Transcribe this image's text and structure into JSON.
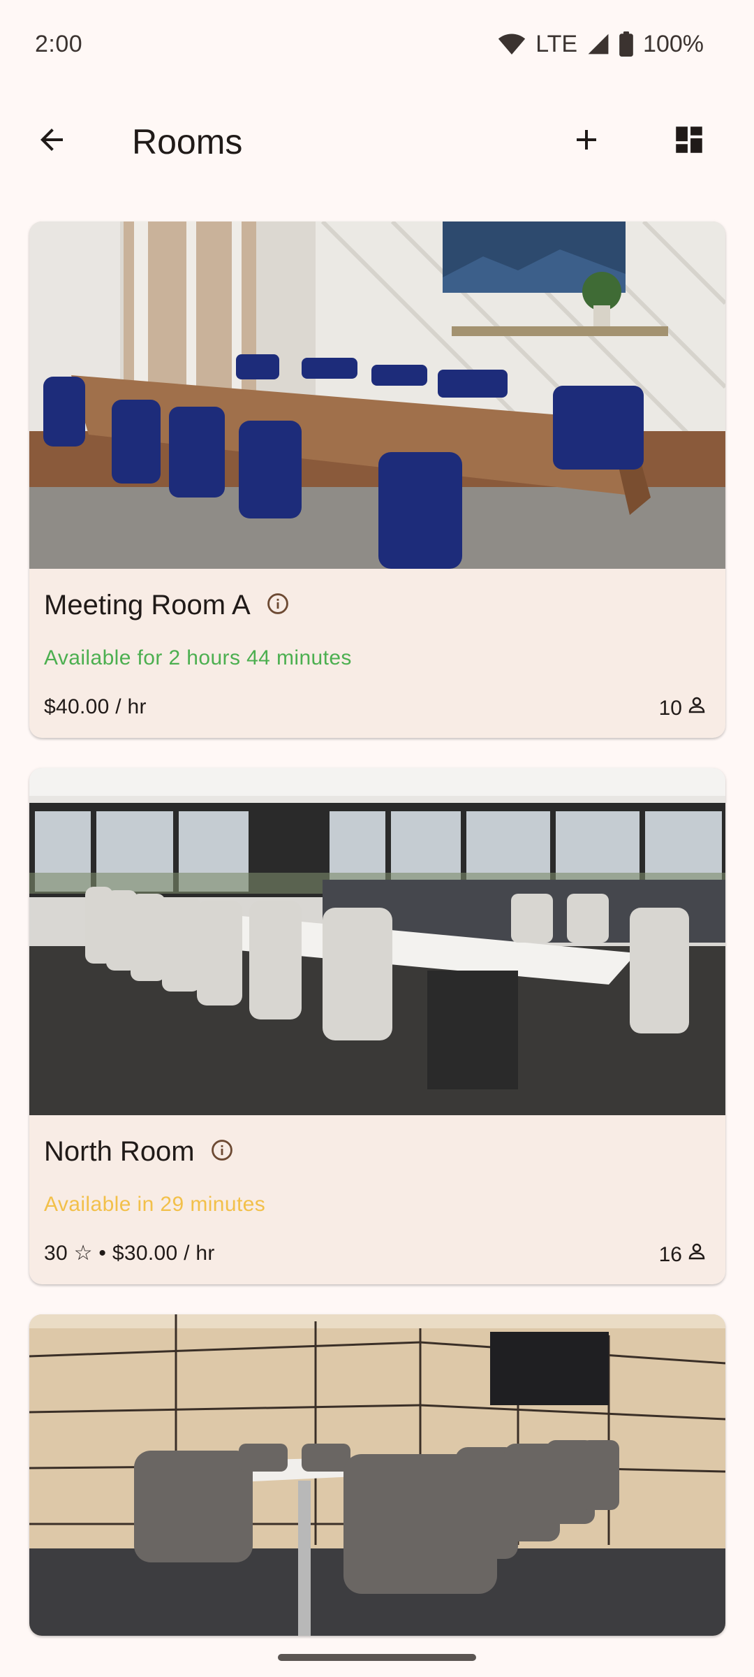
{
  "status_bar": {
    "time": "2:00",
    "network": "LTE",
    "battery": "100%",
    "icons": [
      "wifi-icon",
      "cell-signal-icon",
      "battery-icon"
    ]
  },
  "app_bar": {
    "title": "Rooms",
    "icons": [
      "arrow-back-icon",
      "add-icon",
      "dashboard-icon"
    ]
  },
  "colors": {
    "background": "#fff8f6",
    "card": "#f8ece5",
    "available_now": "#4caf50",
    "available_later": "#f2c04a"
  },
  "rooms": [
    {
      "name": "Meeting Room A",
      "availability": "Available for 2 hours 44 minutes",
      "availability_status": "available-now",
      "price": "$40.00 / hr",
      "capacity": "10",
      "photo": "conference room with wooden table and blue chairs"
    },
    {
      "name": "North Room",
      "availability": "Available in 29 minutes",
      "availability_status": "available-later",
      "price": "30 ☆ • $30.00 / hr",
      "capacity": "16",
      "photo": "boardroom with white table, white chairs and panoramic windows"
    },
    {
      "photo": "small meeting room with paneled walls, TV and grey chairs"
    }
  ]
}
